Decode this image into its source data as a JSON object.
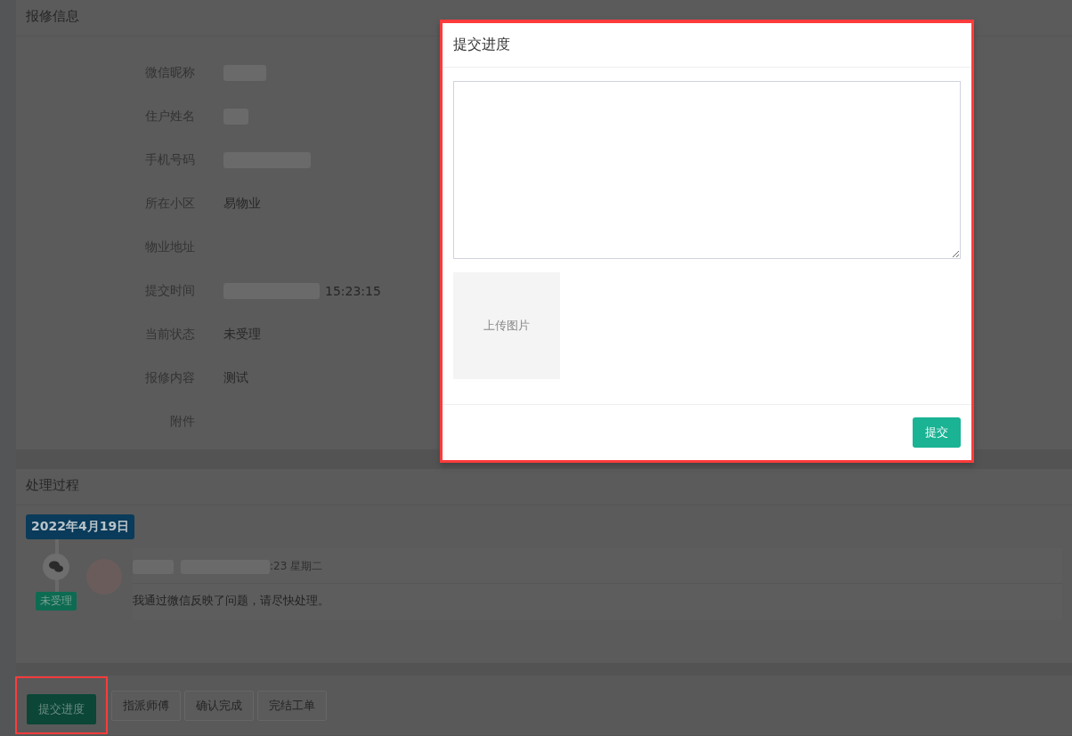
{
  "info_panel": {
    "title": "报修信息",
    "fields": [
      {
        "label": "微信昵称",
        "kind": "redacted"
      },
      {
        "label": "住户姓名",
        "kind": "redacted"
      },
      {
        "label": "手机号码",
        "kind": "redacted"
      },
      {
        "label": "所在小区",
        "kind": "text",
        "value": "易物业"
      },
      {
        "label": "物业地址",
        "kind": "empty"
      },
      {
        "label": "提交时间",
        "kind": "partial",
        "value": "15:23:15"
      },
      {
        "label": "当前状态",
        "kind": "text",
        "value": "未受理"
      },
      {
        "label": "报修内容",
        "kind": "text",
        "value": "测试"
      },
      {
        "label": "附件",
        "kind": "empty"
      }
    ]
  },
  "process_panel": {
    "title": "处理过程",
    "date": "2022年4月19日",
    "entries": [
      {
        "status": "未受理",
        "time": ":23 星期二",
        "message": "我通过微信反映了问题，请尽快处理。"
      }
    ]
  },
  "actions": [
    {
      "label": "提交进度",
      "kind": "primary",
      "highlighted": true
    },
    {
      "label": "指派师傅",
      "kind": "default",
      "highlighted": false
    },
    {
      "label": "确认完成",
      "kind": "default",
      "highlighted": false
    },
    {
      "label": "完结工单",
      "kind": "default",
      "highlighted": false
    }
  ],
  "dialog": {
    "title": "提交进度",
    "upload_label": "上传图片",
    "submit": "提交",
    "highlighted": true
  }
}
